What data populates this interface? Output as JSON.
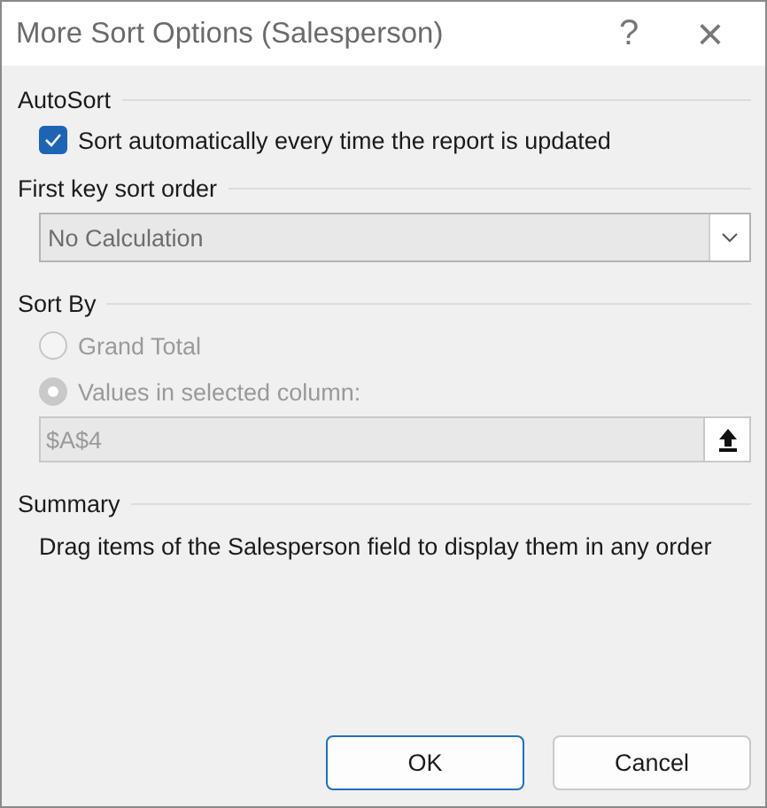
{
  "window": {
    "title": "More Sort Options (Salesperson)",
    "help": "?",
    "close": "×"
  },
  "autosort": {
    "heading": "AutoSort",
    "checkbox": {
      "label": "Sort automatically every time the report is updated",
      "checked": true
    }
  },
  "first_key": {
    "heading": "First key sort order",
    "dropdown": {
      "value": "No Calculation"
    }
  },
  "sort_by": {
    "heading": "Sort By",
    "disabled": true,
    "options": [
      {
        "label": "Grand Total",
        "selected": false
      },
      {
        "label": "Values in selected column:",
        "selected": true
      }
    ],
    "reference": {
      "value": "$A$4"
    }
  },
  "summary": {
    "heading": "Summary",
    "text": "Drag items of the Salesperson field to display them in any order"
  },
  "buttons": [
    {
      "label": "OK",
      "default": true
    },
    {
      "label": "Cancel",
      "default": false
    }
  ]
}
